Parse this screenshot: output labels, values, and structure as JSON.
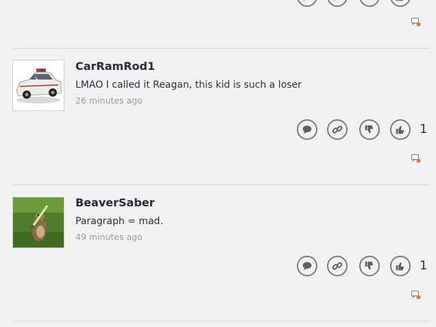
{
  "comments": [
    {
      "username": "CarRamRod1",
      "text": "LMAO I called it Reagan, this kid is such a loser",
      "timestamp": "26 minutes ago",
      "likes": "1",
      "avatar": "police-car"
    },
    {
      "username": "BeaverSaber",
      "text": "Paragraph = mad.",
      "timestamp": "49 minutes ago",
      "likes": "1",
      "avatar": "groundhog-lightsaber"
    }
  ],
  "icons": {
    "reply": "reply-icon",
    "link": "link-icon",
    "dislike": "thumbs-down-icon",
    "like": "thumbs-up-icon",
    "report": "report-flag-icon"
  },
  "colors": {
    "background": "#f1f1f1",
    "icon": "#5f5f66",
    "username": "#2b2b33",
    "timestamp": "#9b9ba3"
  }
}
